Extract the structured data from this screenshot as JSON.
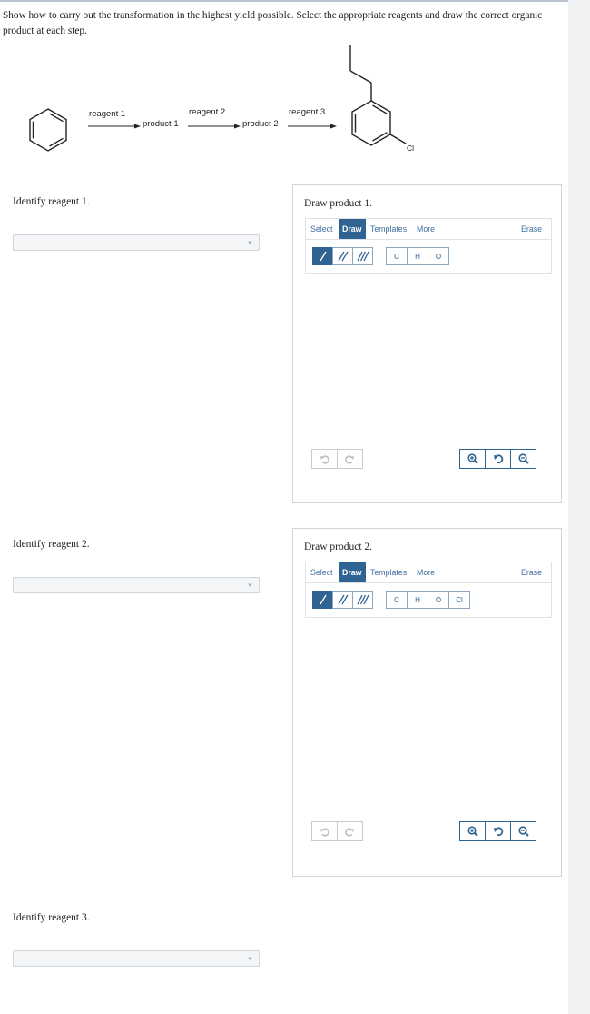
{
  "instructions": "Show how to carry out the transformation in the highest yield possible. Select the appropriate reagents and draw the correct organic product at each step.",
  "scheme": {
    "reagent1": "reagent 1",
    "reagent2": "reagent 2",
    "reagent3": "reagent 3",
    "product1": "product 1",
    "product2": "product 2",
    "substituent_label": "Cl"
  },
  "questions": {
    "reagent1_prompt": "Identify reagent 1.",
    "reagent2_prompt": "Identify reagent 2.",
    "reagent3_prompt": "Identify reagent 3."
  },
  "panels": [
    {
      "title": "Draw product 1.",
      "tabs": [
        "Select",
        "Draw",
        "Templates",
        "More"
      ],
      "active_tab": "Draw",
      "erase": "Erase",
      "atoms": [
        "C",
        "H",
        "O"
      ]
    },
    {
      "title": "Draw product 2.",
      "tabs": [
        "Select",
        "Draw",
        "Templates",
        "More"
      ],
      "active_tab": "Draw",
      "erase": "Erase",
      "atoms": [
        "C",
        "H",
        "O",
        "Cl"
      ]
    }
  ],
  "icons": {
    "single_bond": "single-bond-icon",
    "double_bond": "double-bond-icon",
    "triple_bond": "triple-bond-icon",
    "undo": "undo-icon",
    "redo": "redo-icon",
    "zoom_in": "zoom-in-icon",
    "reset_zoom": "reset-zoom-icon",
    "zoom_out": "zoom-out-icon"
  },
  "colors": {
    "accent": "#2f6391",
    "link": "#3f6f9f",
    "border": "#cfd4da"
  }
}
